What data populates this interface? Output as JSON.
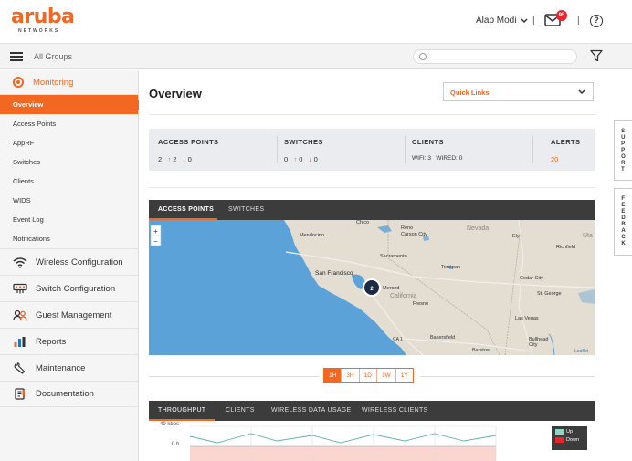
{
  "header": {
    "logo_text": "aruba",
    "logo_sub": "NETWORKS",
    "user_name": "Alap Modi",
    "notification_count": "95",
    "separator": "|",
    "help_label": "?",
    "colors": {
      "brand": "#f26722",
      "badge": "#e8242c"
    }
  },
  "groupbar": {
    "group_label": "All Groups",
    "search_placeholder": ""
  },
  "sidebar": {
    "monitoring_label": "Monitoring",
    "monitoring_items": [
      {
        "label": "Overview",
        "active": true
      },
      {
        "label": "Access Points"
      },
      {
        "label": "AppRF"
      },
      {
        "label": "Switches"
      },
      {
        "label": "Clients"
      },
      {
        "label": "WIDS"
      },
      {
        "label": "Event Log"
      },
      {
        "label": "Notifications"
      }
    ],
    "main_items": [
      {
        "label": "Wireless Configuration",
        "icon": "wifi-icon"
      },
      {
        "label": "Switch Configuration",
        "icon": "switch-icon"
      },
      {
        "label": "Guest Management",
        "icon": "guests-icon"
      },
      {
        "label": "Reports",
        "icon": "bar-chart-icon"
      },
      {
        "label": "Maintenance",
        "icon": "wrench-icon"
      },
      {
        "label": "Documentation",
        "icon": "book-icon"
      }
    ]
  },
  "main": {
    "title": "Overview",
    "quick_links_label": "Quick Links",
    "summary": {
      "access_points": {
        "label": "ACCESS POINTS",
        "total": "2",
        "up": "2",
        "down": "0"
      },
      "switches": {
        "label": "SWITCHES",
        "total": "0",
        "up": "0",
        "down": "0"
      },
      "clients": {
        "label": "CLIENTS",
        "wifi_label": "WIFI:",
        "wifi": "3",
        "wired_label": "WIRED:",
        "wired": "0"
      },
      "alerts": {
        "label": "ALERTS",
        "value": "20"
      }
    },
    "map": {
      "tabs": [
        "ACCESS POINTS",
        "SWITCHES"
      ],
      "zoom_in": "+",
      "zoom_out": "−",
      "cluster_count": "2",
      "attribution": "Leaflet",
      "places": [
        "Chico",
        "Reno",
        "Carson City",
        "Nevada",
        "Ely",
        "Uta",
        "Richfield",
        "Mendocino",
        "Sacramento",
        "San Francisco",
        "Merced",
        "California",
        "Fresno",
        "Tonopah",
        "Cedar City",
        "St. George",
        "Las Vegas",
        "Bakersfield",
        "Barstow",
        "Bullhead City",
        "CA 1"
      ]
    },
    "time_ranges": [
      {
        "label": "1H",
        "active": true
      },
      {
        "label": "3H"
      },
      {
        "label": "1D"
      },
      {
        "label": "1W"
      },
      {
        "label": "1Y"
      }
    ],
    "throughput": {
      "tabs": [
        "THROUGHPUT",
        "CLIENTS",
        "WIRELESS DATA USAGE",
        "WIRELESS CLIENTS"
      ],
      "y_top": "49 kbps",
      "y_zero": "0 b",
      "legend": [
        {
          "label": "Up",
          "color": "#8fd6c9"
        },
        {
          "label": "Down",
          "color": "#e8242c"
        }
      ]
    }
  },
  "side_tabs": {
    "support": "SUPPORT",
    "feedback": "FEEDBACK"
  }
}
